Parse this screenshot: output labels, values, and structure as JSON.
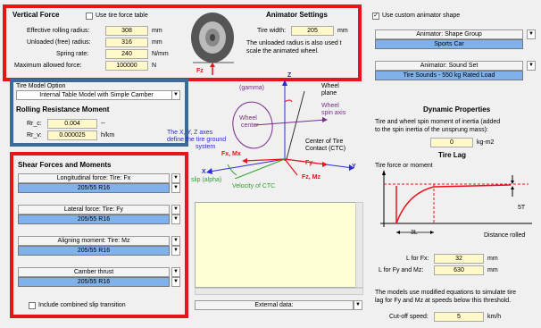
{
  "vertical_force": {
    "title": "Vertical Force",
    "use_table_label": "Use tire force table",
    "rows": [
      {
        "label": "Effective rolling radius:",
        "value": "308",
        "unit": "mm"
      },
      {
        "label": "Unloaded (free) radius:",
        "value": "316",
        "unit": "mm"
      },
      {
        "label": "Spring rate:",
        "value": "240",
        "unit": "N/mm"
      },
      {
        "label": "Maximum allowed force:",
        "value": "100000",
        "unit": "N"
      }
    ],
    "fz_label": "Fz"
  },
  "animator_settings": {
    "title": "Animator Settings",
    "tire_width_label": "Tire width:",
    "tire_width_value": "205",
    "tire_width_unit": "mm",
    "note_line1": "The unloaded radius is also used t",
    "note_line2": "scale the animated wheel."
  },
  "custom_shape": {
    "checkbox_label": "Use custom animator shape",
    "shape_group_label": "Animator: Shape Group",
    "shape_group_value": "Sports Car",
    "sound_set_label": "Animator: Sound Set",
    "sound_set_value": "Tire Sounds - 550 kg Rated Load"
  },
  "tire_model": {
    "option_label": "Tire Model Option",
    "option_value": "Internal Table Model with Simple Camber"
  },
  "rolling_resistance": {
    "title": "Rolling Resistance Moment",
    "rows": [
      {
        "label": "Rr_c:",
        "value": "0.004",
        "unit": "--"
      },
      {
        "label": "Rr_v:",
        "value": "0.000025",
        "unit": "h/km"
      }
    ]
  },
  "shear_forces": {
    "title": "Shear Forces and Moments",
    "items": [
      {
        "label": "Longitudinal force: Tire: Fx",
        "value": "205/55 R16"
      },
      {
        "label": "Lateral force: Tire: Fy",
        "value": "205/55 R16"
      },
      {
        "label": "Aligning moment: Tire: Mz",
        "value": "205/55 R16"
      },
      {
        "label": "Camber thrust",
        "value": "205/55 R16"
      }
    ],
    "combined_slip_label": "Include combined slip transition"
  },
  "diagram": {
    "z_label": "Z",
    "gamma_label": "(gamma)",
    "wheel_plane_label": "Wheel",
    "wheel_plane_label2": "plane",
    "spin_axis_label": "Wheel",
    "spin_axis_label2": "spin axis",
    "wheel_center_label": "Wheel",
    "wheel_center_label2": "center",
    "xyz_note1": "The X, Y, Z axes",
    "xyz_note2": "define the tire ground",
    "xyz_note3": "system",
    "ctc_label1": "Center of Tire",
    "ctc_label2": "Contact (CTC)",
    "fx_mx_label": "Fx, Mx",
    "fy_label": "Fy",
    "y_label": "Y",
    "x_label": "X",
    "fz_mz_label": "Fz, Mz",
    "slip_label": "slip (alpha)",
    "velocity_label": "Velocity of CTC"
  },
  "external_data_label": "External data:",
  "dynamic": {
    "title": "Dynamic Properties",
    "inertia_text1": "Tire and wheel spin moment of inertia (added",
    "inertia_text2": "to the spin inertia of the unsprung mass):",
    "inertia_value": "0",
    "inertia_unit": "kg-m2",
    "lag_title": "Tire Lag",
    "chart_y_label": "Tire force or moment",
    "chart_x_label": "Distance rolled",
    "chart_3l": "3L",
    "chart_5t": "5T",
    "l_fx_label": "L for Fx:",
    "l_fx_value": "32",
    "l_fx_unit": "mm",
    "l_fymz_label": "L for Fy and Mz:",
    "l_fymz_value": "630",
    "l_fymz_unit": "mm",
    "note1": "The models use modified equations to simulate tire",
    "note2": "lag for Fy and Mz at  speeds below this threshold.",
    "cutoff_label": "Cut-off speed:",
    "cutoff_value": "5",
    "cutoff_unit": "km/h"
  }
}
